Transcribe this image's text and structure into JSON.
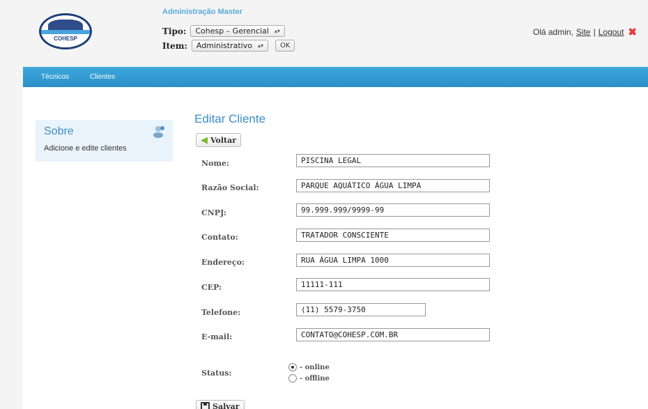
{
  "header": {
    "logo_text": "COHESP",
    "admin_title": "Administração Master",
    "tipo_label": "Tipo:",
    "tipo_value": "Cohesp – Gerencial",
    "item_label": "Item:",
    "item_value": "Administrativo",
    "ok_label": "OK",
    "greeting": "Olá admin,",
    "site_link": "Site",
    "separator": "|",
    "logout_link": "Logout"
  },
  "nav": {
    "items": [
      "Técnicos",
      "Clientes"
    ]
  },
  "sidebar": {
    "title": "Sobre",
    "description": "Adicione e edite clientes"
  },
  "main": {
    "title": "Editar Cliente",
    "back_button": "Voltar",
    "save_button": "Salvar",
    "fields": {
      "nome": {
        "label": "Nome:",
        "value": "PISCINA LEGAL"
      },
      "razao": {
        "label": "Razão Social:",
        "value": "PARQUE AQUÁTICO ÁGUA LIMPA"
      },
      "cnpj": {
        "label": "CNPJ:",
        "value": "99.999.999/9999-99"
      },
      "contato": {
        "label": "Contato:",
        "value": "TRATADOR CONSCIENTE"
      },
      "endereco": {
        "label": "Endereço:",
        "value": "RUA ÁGUA LIMPA 1000"
      },
      "cep": {
        "label": "CEP:",
        "value": "11111-111"
      },
      "telefone": {
        "label": "Telefone:",
        "value": "(11) 5579-3750"
      },
      "email": {
        "label": "E-mail:",
        "value": "CONTATO@COHESP.COM.BR"
      }
    },
    "status": {
      "label": "Status:",
      "options": [
        "- online",
        "- offline"
      ],
      "selected": "- online"
    }
  },
  "icons": {
    "back": "arrow-left-icon",
    "save": "floppy-disk-icon",
    "logout": "close-icon",
    "sidebar": "users-icon"
  },
  "colors": {
    "accent": "#3a8ec8",
    "nav_bar": "#2f9ad4",
    "logout_x": "#e53b3b"
  }
}
